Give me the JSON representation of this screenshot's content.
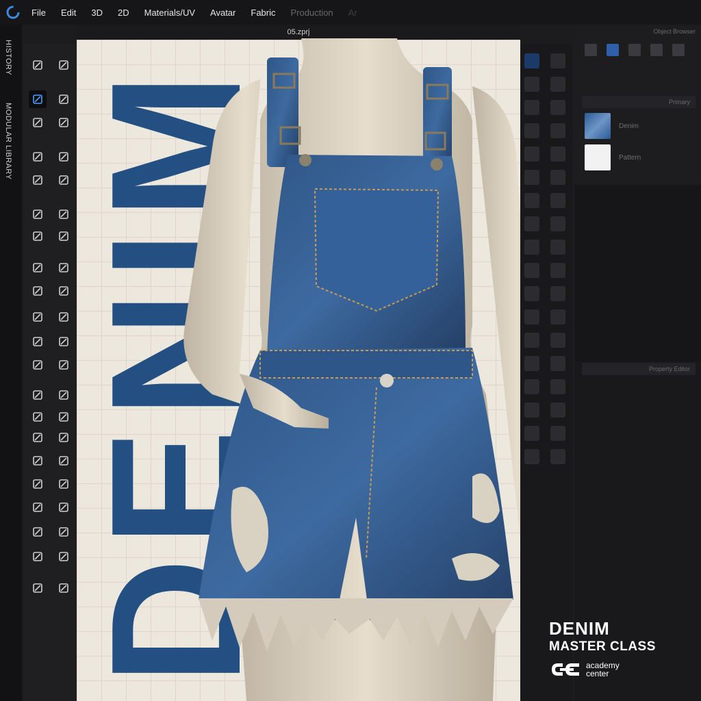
{
  "menu": {
    "items": [
      "File",
      "Edit",
      "3D",
      "2D",
      "Materials/UV",
      "Avatar",
      "Fabric",
      "Production",
      "Ar"
    ]
  },
  "side_tabs": {
    "history": "HISTORY",
    "modular_library": "MODULAR LIBRARY"
  },
  "file": {
    "name": "05.zprj"
  },
  "object_browser": {
    "header": "Object Browser",
    "section_primary": "Primary",
    "fabrics": [
      "Denim",
      "Pattern"
    ],
    "section_properties": "Property Editor"
  },
  "viewport": {
    "big_word": "DENIM"
  },
  "brand": {
    "title": "DENIM",
    "subtitle": "MASTER CLASS",
    "academy_line1": "academy",
    "academy_line2": "center"
  },
  "colors": {
    "accent": "#2f5fa8",
    "denim_text": "#244f82",
    "menubar": "#161618",
    "viewport_bg": "#ede8de"
  }
}
